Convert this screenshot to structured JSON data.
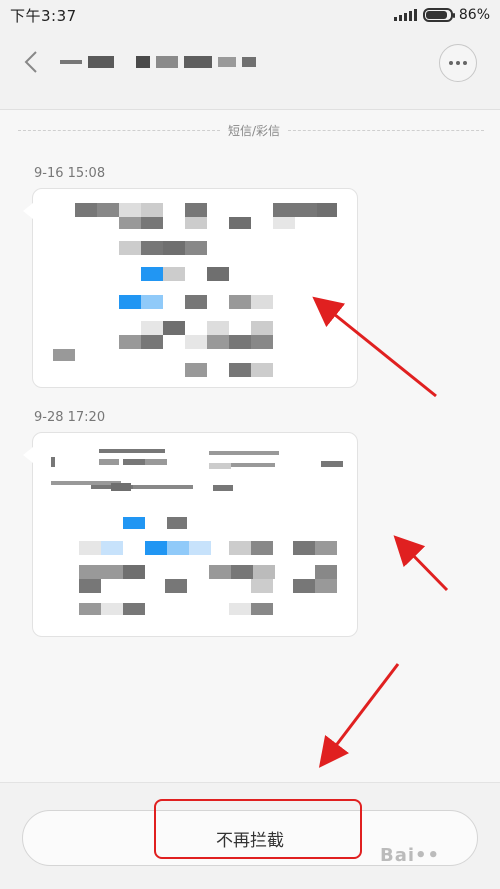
{
  "status_bar": {
    "time": "下午3:37",
    "battery_percent": "86%",
    "battery_level": 0.86
  },
  "header": {
    "back_icon": "chevron-left-icon",
    "more_icon": "more-horizontal-icon"
  },
  "conversation": {
    "channel_label": "短信/彩信",
    "messages": [
      {
        "timestamp": "9-16 15:08"
      },
      {
        "timestamp": "9-28 17:20"
      }
    ]
  },
  "footer": {
    "unblock_label": "不再拦截"
  },
  "colors": {
    "annotation_red": "#e02020",
    "background": "#f7f7f7"
  }
}
